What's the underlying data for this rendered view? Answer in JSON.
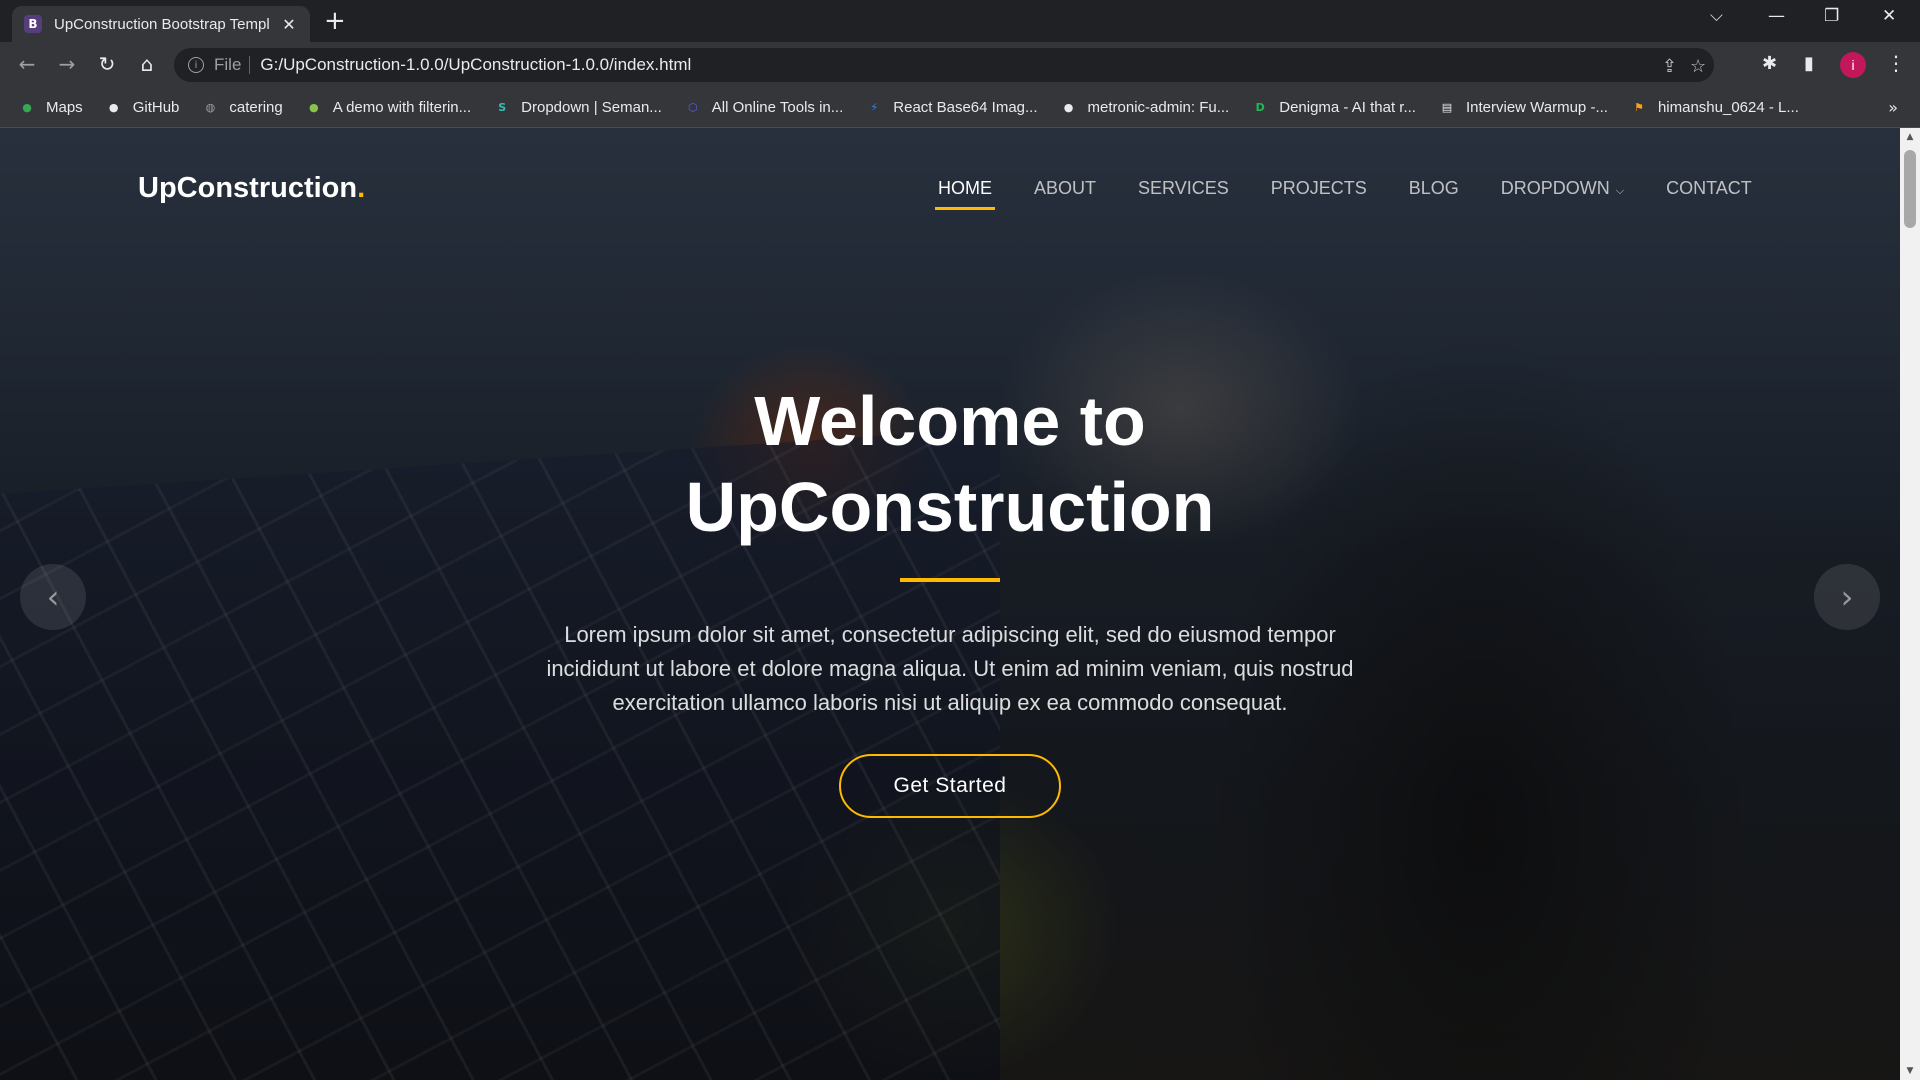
{
  "browser": {
    "tab": {
      "favicon": "B",
      "title": "UpConstruction Bootstrap Templ",
      "close": "✕"
    },
    "new_tab": "+",
    "window_controls": {
      "dropdown": "⌵",
      "minimize": "—",
      "restore": "❐",
      "close": "✕"
    },
    "nav": {
      "back": "←",
      "forward": "→",
      "reload": "↻",
      "home": "⌂"
    },
    "omnibox": {
      "info": "i",
      "scheme": "File",
      "url": "G:/UpConstruction-1.0.0/UpConstruction-1.0.0/index.html",
      "share": "⇪",
      "star": "☆"
    },
    "toolbar_icons": {
      "extensions": "✱",
      "sidepanel": "▮",
      "profile_letter": "i",
      "menu": "⋮"
    },
    "bookmarks": [
      {
        "label": "Maps",
        "icon": "maps-icon",
        "glyph": "●",
        "color": "#34a853"
      },
      {
        "label": "GitHub",
        "icon": "github-icon",
        "glyph": "●",
        "color": "#e8eaed"
      },
      {
        "label": "catering",
        "icon": "globe-icon",
        "glyph": "◍",
        "color": "#9aa0a6"
      },
      {
        "label": "A demo with filterin...",
        "icon": "demo-icon",
        "glyph": "●",
        "color": "#8bc34a"
      },
      {
        "label": "Dropdown | Seman...",
        "icon": "semantic-icon",
        "glyph": "S",
        "color": "#35bdb2"
      },
      {
        "label": "All Online Tools in...",
        "icon": "tools-icon",
        "glyph": "⬡",
        "color": "#5b5bf0"
      },
      {
        "label": "React Base64 Imag...",
        "icon": "react-icon",
        "glyph": "⚡",
        "color": "#3b82f6"
      },
      {
        "label": "metronic-admin: Fu...",
        "icon": "github-icon",
        "glyph": "●",
        "color": "#e8eaed"
      },
      {
        "label": "Denigma - AI that r...",
        "icon": "denigma-icon",
        "glyph": "D",
        "color": "#1db954"
      },
      {
        "label": "Interview Warmup -...",
        "icon": "doc-icon",
        "glyph": "▤",
        "color": "#e8eaed"
      },
      {
        "label": "himanshu_0624 - L...",
        "icon": "leetcode-icon",
        "glyph": "⚑",
        "color": "#ffa116"
      }
    ],
    "bookmarks_more": "»"
  },
  "site": {
    "logo": {
      "text": "UpConstruction",
      "dot": "."
    },
    "nav": [
      "HOME",
      "ABOUT",
      "SERVICES",
      "PROJECTS",
      "BLOG",
      "DROPDOWN",
      "CONTACT"
    ],
    "dropdown_chevron": "⌵",
    "hero": {
      "title_line1": "Welcome to",
      "title_line2": "UpConstruction",
      "text": "Lorem ipsum dolor sit amet, consectetur adipiscing elit, sed do eiusmod tempor incididunt ut labore et dolore magna aliqua. Ut enim ad minim veniam, quis nostrud exercitation ullamco laboris nisi ut aliquip ex ea commodo consequat.",
      "button": "Get Started"
    },
    "carousel": {
      "prev": "‹",
      "next": "›"
    }
  },
  "colors": {
    "accent": "#feb900",
    "chrome_dark": "#202124",
    "chrome": "#35363a"
  }
}
